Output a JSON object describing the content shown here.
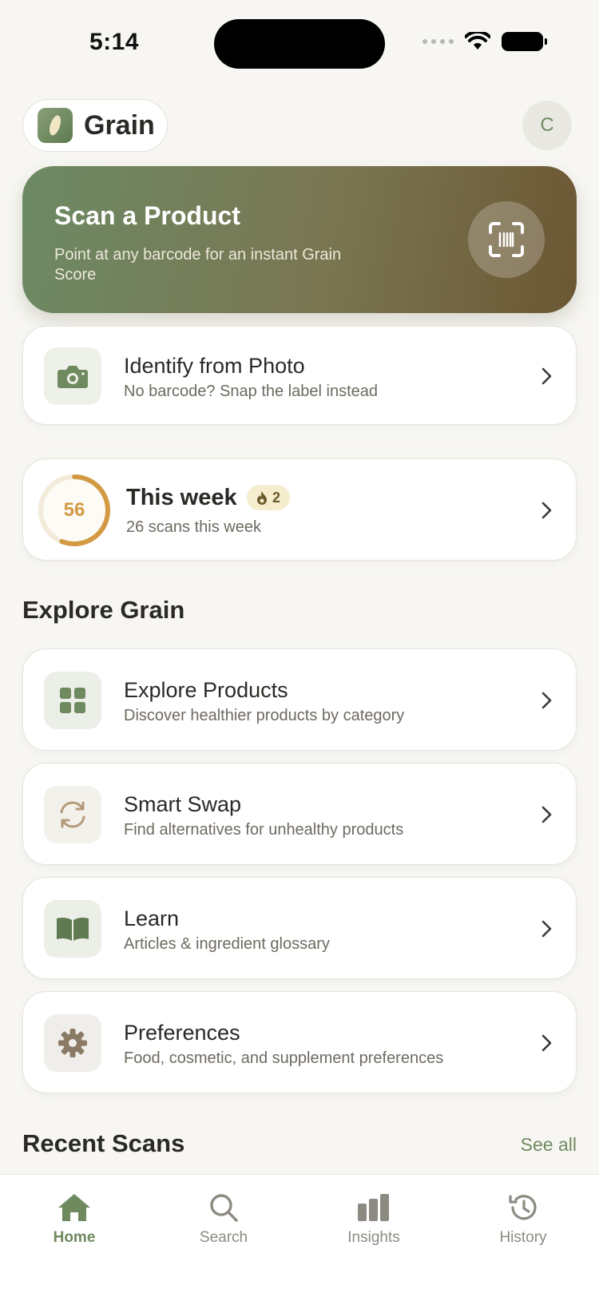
{
  "status": {
    "time": "5:14"
  },
  "header": {
    "brand": "Grain",
    "avatar_initial": "C"
  },
  "scan": {
    "title": "Scan a Product",
    "subtitle": "Point at any barcode for an instant Grain Score"
  },
  "photo": {
    "title": "Identify from Photo",
    "subtitle": "No barcode? Snap the label instead"
  },
  "week": {
    "score": "56",
    "score_fraction": 0.56,
    "title": "This week",
    "streak": "2",
    "subtitle": "26 scans this week"
  },
  "explore": {
    "title": "Explore Grain",
    "items": [
      {
        "title": "Explore Products",
        "subtitle": "Discover healthier products by category",
        "icon": "grid-icon"
      },
      {
        "title": "Smart Swap",
        "subtitle": "Find alternatives for unhealthy products",
        "icon": "swap-icon"
      },
      {
        "title": "Learn",
        "subtitle": "Articles & ingredient glossary",
        "icon": "book-icon"
      },
      {
        "title": "Preferences",
        "subtitle": "Food, cosmetic, and supplement preferences",
        "icon": "gear-icon"
      }
    ]
  },
  "recent": {
    "title": "Recent Scans",
    "see_all": "See all"
  },
  "tabs": [
    {
      "label": "Home",
      "icon": "home-icon",
      "active": true
    },
    {
      "label": "Search",
      "icon": "search-icon",
      "active": false
    },
    {
      "label": "Insights",
      "icon": "bar-chart-icon",
      "active": false
    },
    {
      "label": "History",
      "icon": "history-icon",
      "active": false
    }
  ],
  "colors": {
    "background": "#f7f6f2",
    "accent_green": "#6f8a5f",
    "ring_gold": "#d39a44"
  }
}
